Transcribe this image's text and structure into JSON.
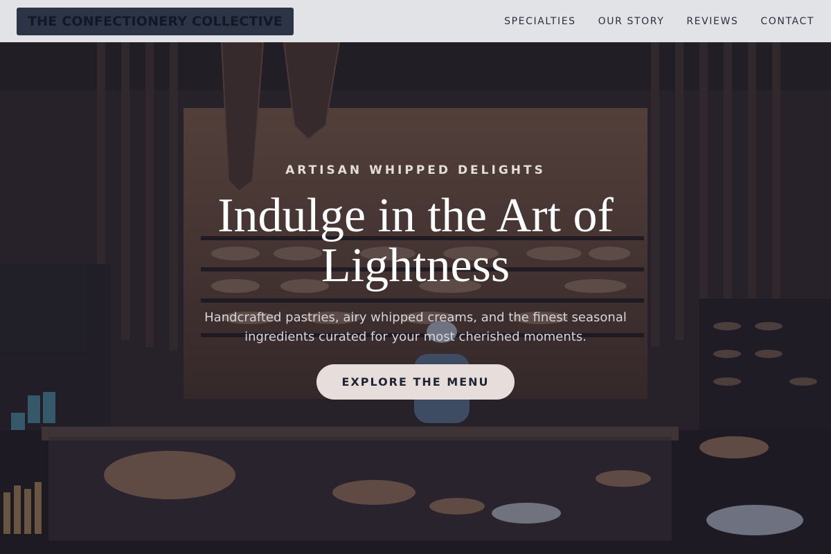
{
  "brand": {
    "name": "THE CONFECTIONERY COLLECTIVE"
  },
  "nav": {
    "items": [
      {
        "label": "SPECIALTIES"
      },
      {
        "label": "OUR STORY"
      },
      {
        "label": "REVIEWS"
      },
      {
        "label": "CONTACT"
      }
    ]
  },
  "hero": {
    "eyebrow": "ARTISAN WHIPPED DELIGHTS",
    "headline": "Indulge in the Art of Lightness",
    "subtext": "Handcrafted pastries, airy whipped creams, and the finest seasonal ingredients curated for your most cherished moments.",
    "cta_label": "EXPLORE THE MENU"
  },
  "colors": {
    "header_bg": "#e2e3e6",
    "logo_bg": "#2d3445",
    "cta_bg": "#e7dedb",
    "overlay": "rgba(24,26,44,0.55)"
  }
}
